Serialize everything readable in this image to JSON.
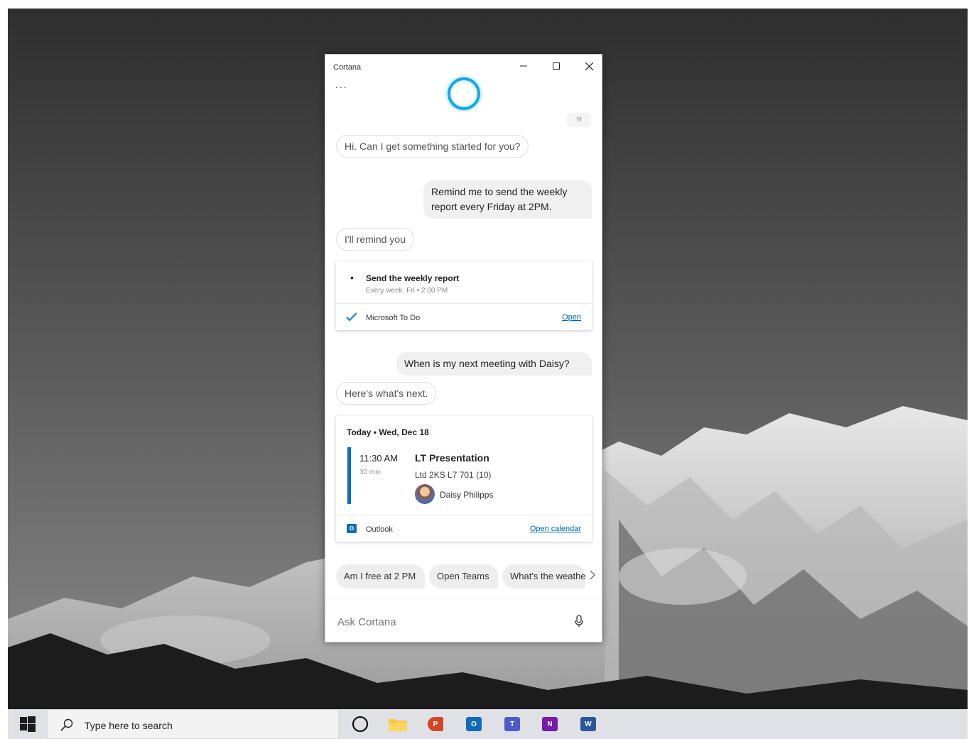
{
  "window": {
    "title": "Cortana",
    "more_label": "...",
    "scroll_hint": "I'll"
  },
  "conversation": {
    "greeting": "Hi. Can I get something started for you?",
    "user_reminder_request": "Remind me to send the weekly report every Friday at 2PM.",
    "reminder_reply": "I'll remind you",
    "user_meeting_question": "When is my next meeting with Daisy?",
    "meeting_reply": "Here's what's next."
  },
  "todo_card": {
    "bullet": "•",
    "task_title": "Send the weekly report",
    "task_schedule": "Every week, Fri • 2:00 PM",
    "app_name": "Microsoft To Do",
    "open_link": "Open",
    "icon": "checkmark-icon",
    "accent_color": "#0078d4"
  },
  "calendar_card": {
    "header": "Today • Wed, Dec 18",
    "event_time": "11:30 AM",
    "event_duration": "30 min",
    "event_title": "LT Presentation",
    "event_location": "Ltd 2KS L7 701 (10)",
    "attendee": "Daisy Philipps",
    "app_name": "Outlook",
    "open_link": "Open calendar",
    "bar_color": "#0f6cbd"
  },
  "suggestions": [
    {
      "label": "Am I free at 2 PM"
    },
    {
      "label": "Open Teams"
    },
    {
      "label": "What's the weather"
    }
  ],
  "ask": {
    "placeholder": "Ask Cortana"
  },
  "taskbar": {
    "search_placeholder": "Type here to search",
    "apps": [
      {
        "name": "cortana",
        "icon": "cortana-ring-icon"
      },
      {
        "name": "file-explorer",
        "icon": "folder-icon",
        "color": "#f7c842"
      },
      {
        "name": "powerpoint",
        "icon": "powerpoint-icon",
        "letter": "P",
        "color": "#d24726"
      },
      {
        "name": "outlook",
        "icon": "outlook-icon",
        "letter": "O",
        "color": "#0f6cbd"
      },
      {
        "name": "teams",
        "icon": "teams-icon",
        "letter": "T",
        "color": "#5059c9"
      },
      {
        "name": "onenote",
        "icon": "onenote-icon",
        "letter": "N",
        "color": "#7719aa"
      },
      {
        "name": "word",
        "icon": "word-icon",
        "letter": "W",
        "color": "#2b579a"
      }
    ]
  }
}
